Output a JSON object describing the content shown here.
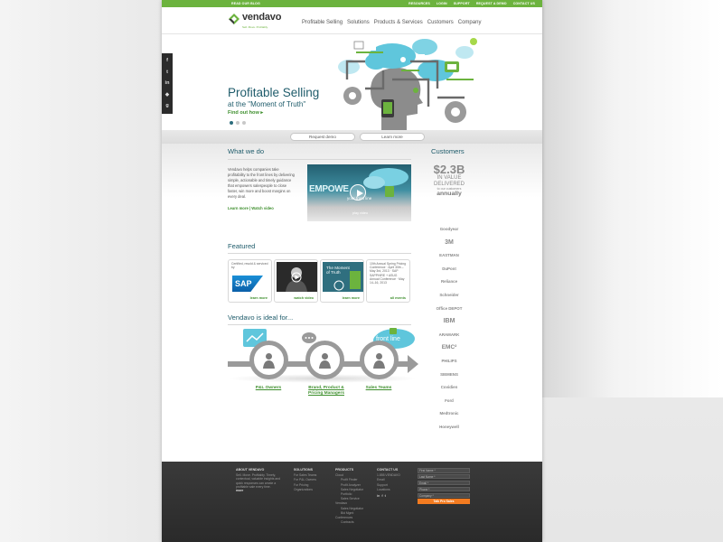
{
  "topbar": {
    "blog": "READ OUR BLOG",
    "links": [
      "RESOURCES",
      "LOGIN",
      "SUPPORT",
      "REQUEST A DEMO",
      "CONTACT US"
    ]
  },
  "header": {
    "logo": "vendavo",
    "tagline": "Sell. Move. Profitably.",
    "nav": [
      "Profitable Selling",
      "Solutions",
      "Products & Services",
      "Customers",
      "Company"
    ]
  },
  "social": [
    "f",
    "t",
    "in",
    "◆",
    "g"
  ],
  "hero": {
    "title": "Profitable Selling",
    "subtitle": "at the \"Moment of Truth\"",
    "link": "Find out how ▸"
  },
  "cta": {
    "request": "Request demo",
    "learn": "Learn more"
  },
  "what": {
    "title": "What we do",
    "text": "Vendavo helps companies take profitability to the front lines by delivering simple, actionable and timely guidance that empowers salespeople to close faster, win more and boost margins on every deal.",
    "links": "Learn more | Watch video",
    "video_word": "EMPOWE",
    "video_sub": "your front line",
    "video_label": "play video"
  },
  "featured": {
    "title": "Featured",
    "cards": [
      {
        "text": "Certified, resold & serviced by",
        "logo": "SAP",
        "link": "learn more"
      },
      {
        "link": "watch video"
      },
      {
        "text": "The Moment of Truth",
        "link": "learn more"
      },
      {
        "text": "10th Annual Spring Pricing Conference · April 30th – May 3rd, 2013 · SAP SAPPHIRE + ASUG Annual Conference · May 14–16, 2013",
        "link": "all events"
      }
    ]
  },
  "ideal": {
    "title": "Vendavo is ideal for...",
    "cloud": "front line",
    "groups": [
      "P&L Owners",
      "Brand, Product & Pricing Managers",
      "Sales Teams"
    ]
  },
  "customers": {
    "title": "Customers",
    "stat_big": "$2.3B",
    "stat_line1": "IN VALUE",
    "stat_line2": "DELIVERED",
    "stat_tiny": "to our customers",
    "stat_bold": "annually",
    "logos": [
      "Goodyear",
      "3M",
      "EASTMAN",
      "DuPont",
      "Reliance",
      "Schneider",
      "Office DEPOT",
      "IBM",
      "ARAMARK",
      "EMC²",
      "PHILIPS",
      "SIEMENS",
      "Covidien",
      "Ford",
      "Medtronic",
      "Honeywell"
    ]
  },
  "footer": {
    "about_hd": "ABOUT VENDAVO",
    "about_text": "Sell. Move. Profitably. Timely, contextual, valuable insights and quick responses can create a profitable sale every time.",
    "about_more": "more",
    "solutions_hd": "SOLUTIONS",
    "solutions": [
      "For Sales Teams",
      "For P&L Owners",
      "For Pricing",
      "Organizations"
    ],
    "products_hd": "PRODUCTS",
    "products": [
      "Cloud",
      "Profit Finder",
      "Profit Analyzer",
      "Sales Negotiator",
      "Portfolio",
      "Sales Service",
      "Vendavo",
      "Sales Negotiator",
      "Bid Mgmt",
      "Conferences",
      "Contracts"
    ],
    "contact_hd": "CONTACT US",
    "contact": [
      "1.855.VENDAVO",
      "Email",
      "Support",
      "Locations"
    ],
    "form": [
      "First Name *",
      "Last Name *",
      "Email *",
      "Phone *",
      "Company *"
    ],
    "form_button": "Talk Pro Sales"
  },
  "colors": {
    "brand_green": "#6cb33e",
    "link_green": "#3e8f2d",
    "title_teal": "#1f5c6b",
    "footer_orange": "#f37b20"
  }
}
